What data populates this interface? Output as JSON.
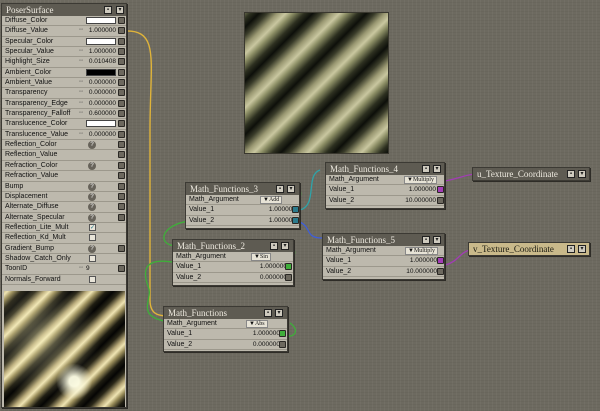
{
  "poser": {
    "title": "PoserSurface",
    "rows": [
      {
        "label": "Diffuse_Color",
        "kind": "color",
        "color": "#ffffff"
      },
      {
        "label": "Diffuse_Value",
        "kind": "value",
        "value": "1.000000"
      },
      {
        "label": "Specular_Color",
        "kind": "color",
        "color": "#ffffff"
      },
      {
        "label": "Specular_Value",
        "kind": "value",
        "value": "1.000000"
      },
      {
        "label": "Highlight_Size",
        "kind": "value",
        "value": "0.010408"
      },
      {
        "label": "Ambient_Color",
        "kind": "color",
        "color": "#000000"
      },
      {
        "label": "Ambient_Value",
        "kind": "value",
        "value": "0.000000"
      },
      {
        "label": "Transparency",
        "kind": "value",
        "value": "0.000000"
      },
      {
        "label": "Transparency_Edge",
        "kind": "value",
        "value": "0.000000"
      },
      {
        "label": "Transparency_Falloff",
        "kind": "value",
        "value": "0.600000"
      },
      {
        "label": "Translucence_Color",
        "kind": "color",
        "color": "#ffffff"
      },
      {
        "label": "Translucence_Value",
        "kind": "value",
        "value": "0.000000"
      },
      {
        "label": "Reflection_Color",
        "kind": "q"
      },
      {
        "label": "Reflection_Value",
        "kind": "plain"
      },
      {
        "label": "Refraction_Color",
        "kind": "q"
      },
      {
        "label": "Refraction_Value",
        "kind": "plain"
      },
      {
        "label": "Bump",
        "kind": "q"
      },
      {
        "label": "Displacement",
        "kind": "q"
      },
      {
        "label": "Alternate_Diffuse",
        "kind": "q"
      },
      {
        "label": "Alternate_Specular",
        "kind": "q"
      },
      {
        "label": "Reflection_Lite_Mult",
        "kind": "check",
        "checked": true
      },
      {
        "label": "Reflection_Kd_Mult",
        "kind": "check",
        "checked": false
      },
      {
        "label": "Gradient_Bump",
        "kind": "q"
      },
      {
        "label": "Shadow_Catch_Only",
        "kind": "check",
        "checked": false
      },
      {
        "label": "ToonID",
        "kind": "value",
        "value": "9"
      },
      {
        "label": "Normals_Forward",
        "kind": "check",
        "checked": false
      }
    ]
  },
  "nodes": {
    "mf3": {
      "title": "Math_Functions_3",
      "operation": "Add",
      "arg_label": "Math_Argument",
      "value1_label": "Value_1",
      "value1": "1.000000",
      "value2_label": "Value_2",
      "value2": "1.000000"
    },
    "mf2": {
      "title": "Math_Functions_2",
      "operation": "Sin",
      "arg_label": "Math_Argument",
      "value1_label": "Value_1",
      "value1": "1.000000",
      "value2_label": "Value_2",
      "value2": "0.000000"
    },
    "mf": {
      "title": "Math_Functions",
      "operation": "Abs",
      "arg_label": "Math_Argument",
      "value1_label": "Value_1",
      "value1": "1.000000",
      "value2_label": "Value_2",
      "value2": "0.000000"
    },
    "mf4": {
      "title": "Math_Functions_4",
      "operation": "Multiply",
      "arg_label": "Math_Argument",
      "value1_label": "Value_1",
      "value1": "1.000000",
      "value2_label": "Value_2",
      "value2": "10.000000"
    },
    "mf5": {
      "title": "Math_Functions_5",
      "operation": "Multiply",
      "arg_label": "Math_Argument",
      "value1_label": "Value_1",
      "value1": "1.000000",
      "value2_label": "Value_2",
      "value2": "10.000000"
    },
    "ucoord": {
      "title": "u_Texture_Coordinate"
    },
    "vcoord": {
      "title": "v_Texture_Coordinate"
    }
  },
  "colors": {
    "wire_yellow": "#e0b43a",
    "wire_green": "#3fae3a",
    "wire_teal": "#2fa3a8",
    "wire_blue": "#3f5ed8",
    "wire_purple": "#a23cb5",
    "vcoord_title_bg": "#c9b98a"
  }
}
